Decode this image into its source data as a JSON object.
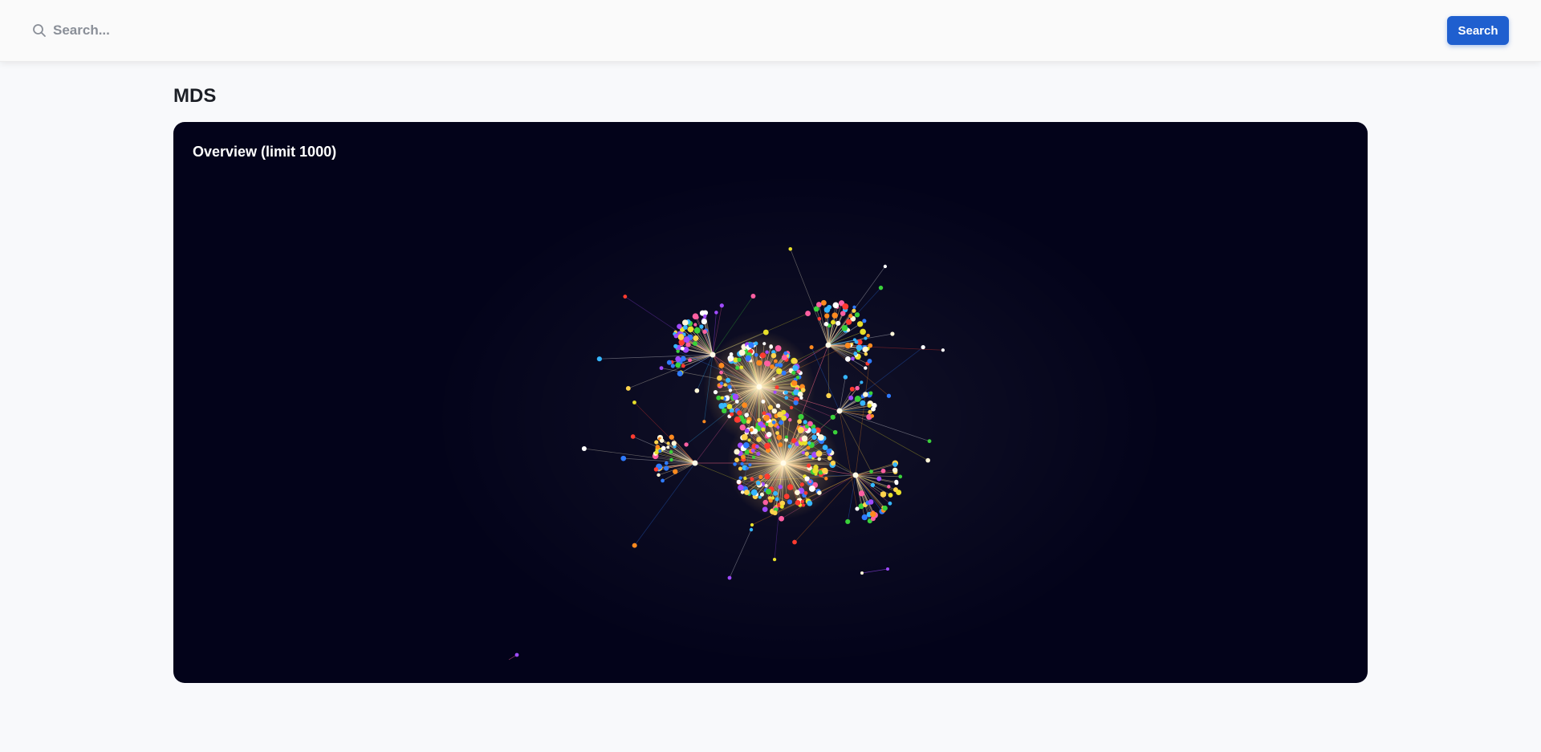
{
  "search": {
    "placeholder": "Search...",
    "value": "",
    "button_label": "Search"
  },
  "page": {
    "title": "MDS"
  },
  "graph": {
    "title": "Overview (limit 1000)",
    "background": "#03031a",
    "glow_color": "#ffe6b0",
    "node_colors": [
      "#ffffff",
      "#fff6d8",
      "#ffd34d",
      "#ff8a1f",
      "#ff3b30",
      "#e8e02a",
      "#3ad13a",
      "#2f7bff",
      "#36b6ff",
      "#a04bff",
      "#ff5fa2"
    ]
  }
}
